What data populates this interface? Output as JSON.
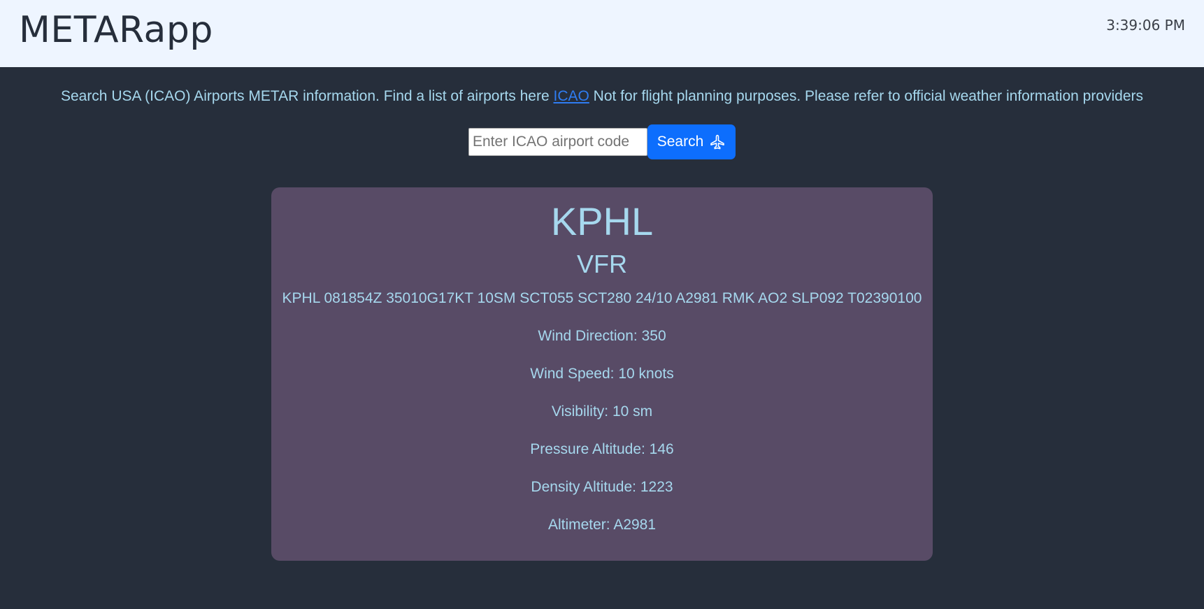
{
  "header": {
    "app_title": "METARapp",
    "clock": "3:39:06 PM"
  },
  "intro": {
    "before_link": "Search USA (ICAO) Airports METAR information. Find a list of airports here",
    "link_text": "ICAO",
    "after_link": "Not for flight planning purposes. Please refer to official weather information providers"
  },
  "search": {
    "value": "",
    "placeholder": "Enter ICAO airport code",
    "button_label": "Search",
    "button_icon": "airplane-icon"
  },
  "result": {
    "station": "KPHL",
    "flight_category": "VFR",
    "raw_metar": "KPHL 081854Z 35010G17KT 10SM SCT055 SCT280 24/10 A2981 RMK AO2 SLP092 T02390100",
    "details": [
      "Wind Direction: 350",
      "Wind Speed: 10 knots",
      "Visibility: 10 sm",
      "Pressure Altitude: 146",
      "Density Altitude: 1223",
      "Altimeter: A2981"
    ]
  },
  "colors": {
    "background": "#262e3b",
    "header_background": "#eef5ff",
    "card_background": "#584b66",
    "text_accent": "#a6d8ee",
    "button": "#0d6efd",
    "link": "#2f7df2"
  }
}
